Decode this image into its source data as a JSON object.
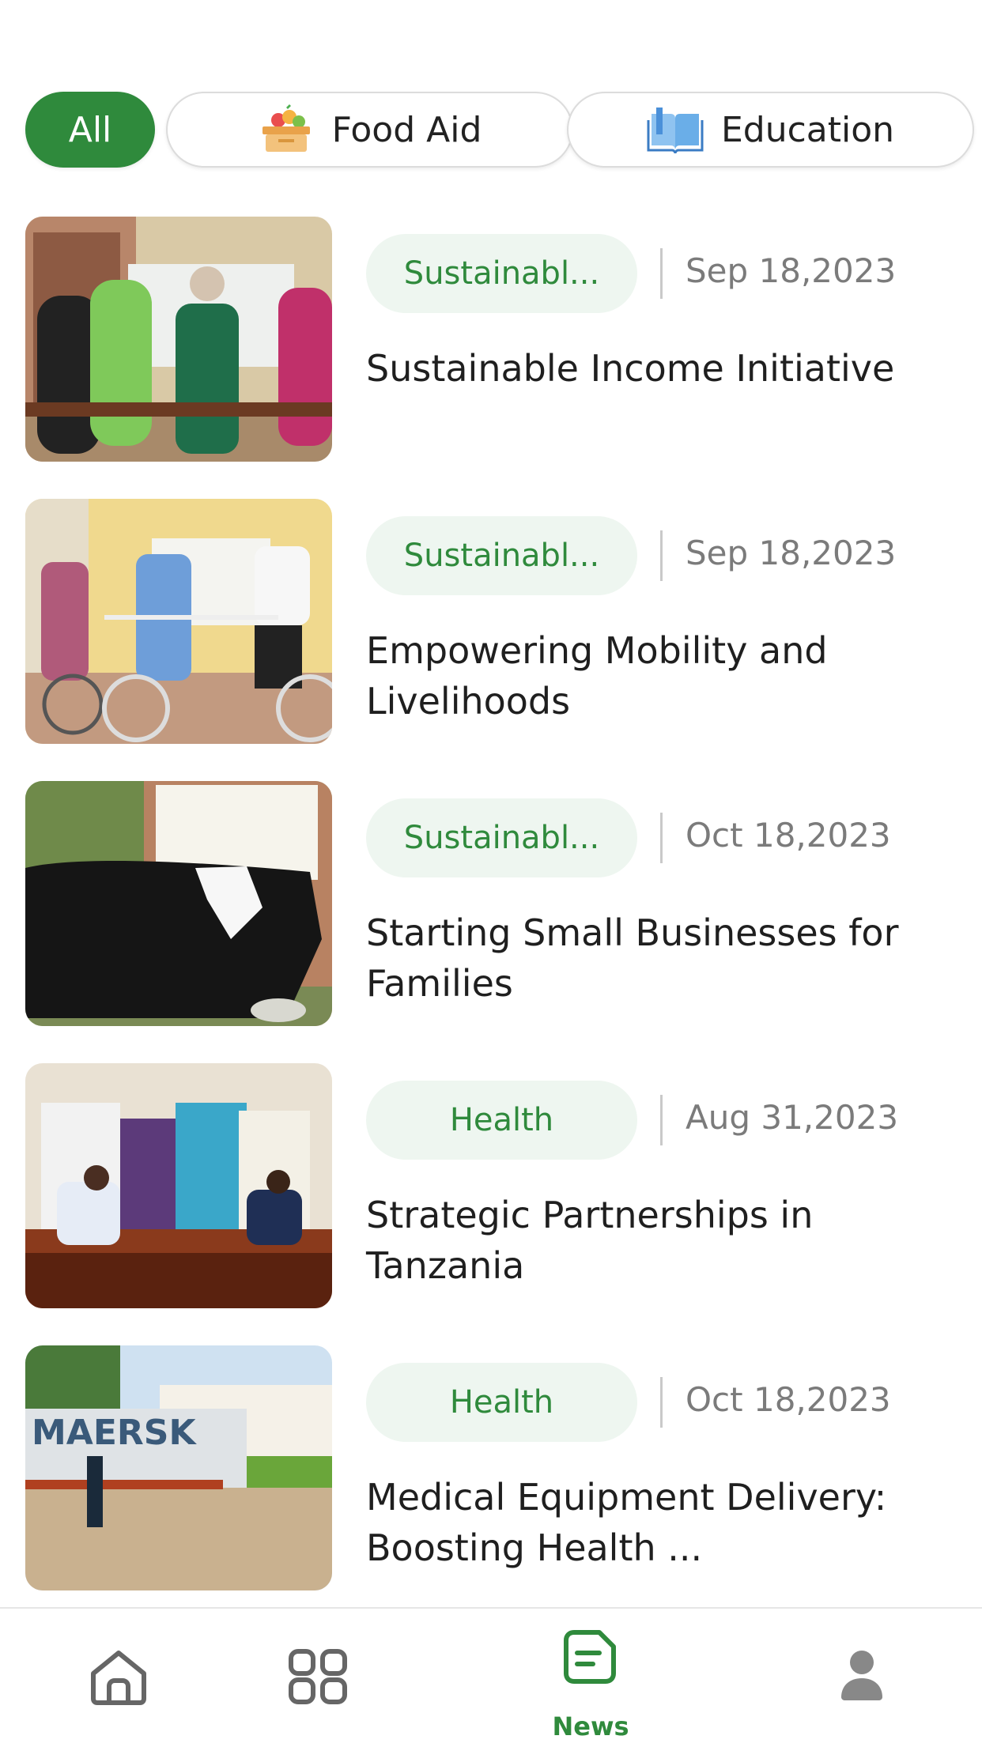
{
  "filters": [
    {
      "label": "All",
      "icon": "",
      "active": true
    },
    {
      "label": "Food Aid",
      "icon": "food-basket-icon",
      "active": false
    },
    {
      "label": "Education",
      "icon": "book-icon",
      "active": false
    }
  ],
  "news": [
    {
      "category": "Sustainabl...",
      "date": "Sep 18,2023",
      "title": "Sustainable Income Initiative",
      "image": "sewing-workshop-photo"
    },
    {
      "category": "Sustainabl...",
      "date": "Sep 18,2023",
      "title": "Empowering Mobility and Livelihoods",
      "image": "bicycle-donation-photo"
    },
    {
      "category": "Sustainabl...",
      "date": "Oct 18,2023",
      "title": "Starting Small Businesses for Families",
      "image": "milking-cow-photo"
    },
    {
      "category": "Health",
      "date": "Aug 31,2023",
      "title": "Strategic Partnerships in Tanzania",
      "image": "partnership-meeting-photo"
    },
    {
      "category": "Health",
      "date": "Oct 18,2023",
      "title": "Medical Equipment Delivery: Boosting Health ...",
      "image": "container-truck-photo"
    }
  ],
  "bottom_nav": [
    {
      "icon": "home-icon",
      "label": "",
      "active": false
    },
    {
      "icon": "grid-icon",
      "label": "",
      "active": false
    },
    {
      "icon": "news-icon",
      "label": "News",
      "active": true
    },
    {
      "icon": "profile-icon",
      "label": "",
      "active": false
    }
  ],
  "colors": {
    "accent": "#2f8a3c",
    "badge_bg": "#eef6f0",
    "muted": "#7b7b7b"
  }
}
